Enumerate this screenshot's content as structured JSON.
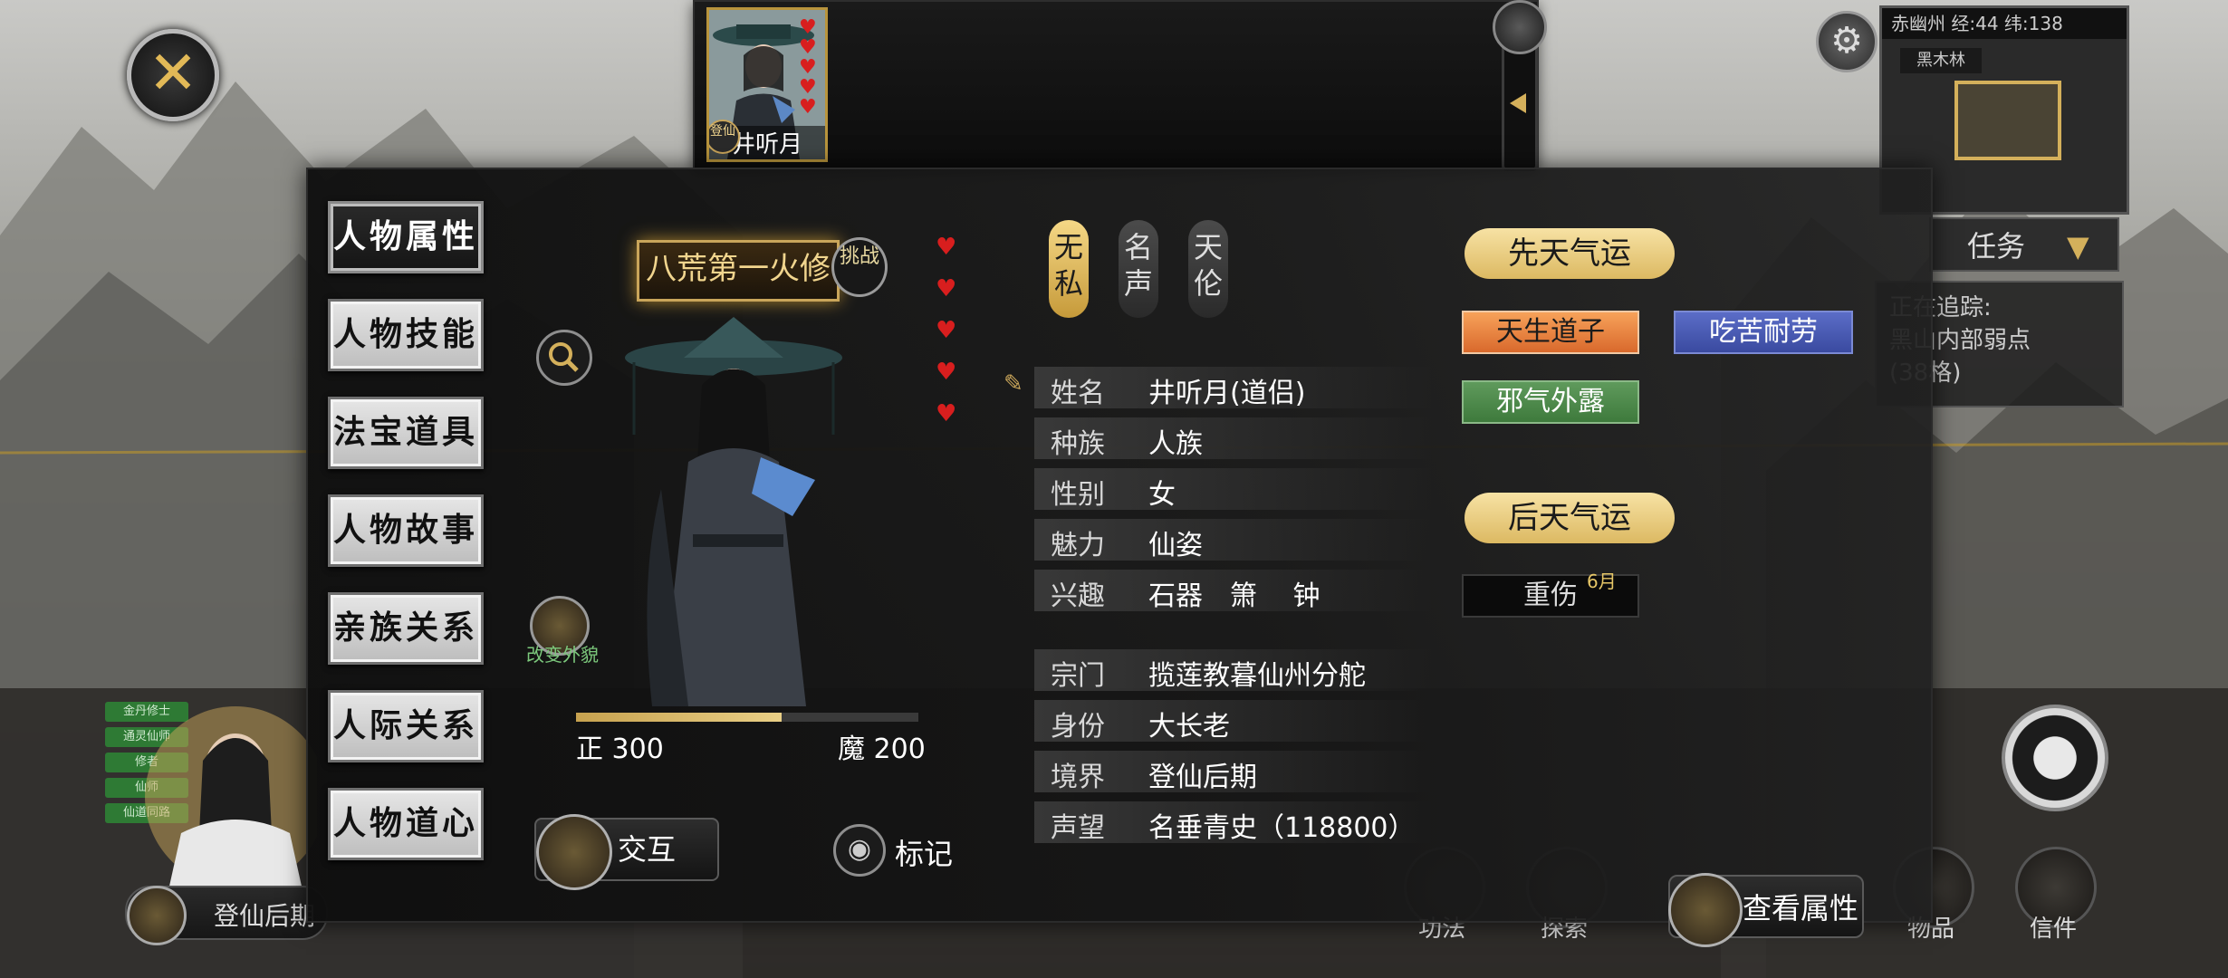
{
  "top": {
    "portrait_name": "井听月",
    "portrait_badge": "登仙",
    "hearts": 5
  },
  "minimap": {
    "title": "赤幽州 经:44 纬:138",
    "subtitle": "黑木林"
  },
  "task": {
    "tab_label": "任务",
    "tracker_title": "正在追踪:",
    "tracker_lines": [
      "黑山内部弱点",
      "(38格)"
    ]
  },
  "nav": {
    "items": [
      "人物属性",
      "人物技能",
      "法宝道具",
      "人物故事",
      "亲族关系",
      "人际关系",
      "人物道心"
    ],
    "active_index": 0
  },
  "character": {
    "title_badge": "八荒第一火修",
    "challenge_label": "挑战",
    "appearance_label": "改变外貌",
    "righteous_label": "正 300",
    "demonic_label": "魔 200",
    "righteous_fraction": 0.6,
    "interact_label": "交互",
    "mark_label": "标记",
    "hearts": 5
  },
  "tabs": [
    {
      "line1": "无",
      "line2": "私",
      "active": true
    },
    {
      "line1": "名",
      "line2": "声",
      "active": false
    },
    {
      "line1": "天",
      "line2": "伦",
      "active": false
    }
  ],
  "info": {
    "rows1": [
      {
        "key": "姓名",
        "value": "井听月(道侣)"
      },
      {
        "key": "种族",
        "value": "人族"
      },
      {
        "key": "性别",
        "value": "女"
      },
      {
        "key": "魅力",
        "value": "仙姿"
      },
      {
        "key": "兴趣",
        "value": "石器　箫　 钟"
      }
    ],
    "rows2": [
      {
        "key": "宗门",
        "value": "揽莲教暮仙州分舵"
      },
      {
        "key": "身份",
        "value": "大长老"
      },
      {
        "key": "境界",
        "value": "登仙后期"
      },
      {
        "key": "声望",
        "value": "名垂青史（118800）"
      }
    ]
  },
  "fortune": {
    "innate_title": "先天气运",
    "innate_traits": [
      "天生道子",
      "吃苦耐劳",
      "邪气外露"
    ],
    "trait_colors": [
      "#e27a34",
      "#4656b0",
      "#4f8a4c"
    ],
    "acquired_title": "后天气运",
    "acquired": {
      "label": "重伤",
      "duration": "6月"
    }
  },
  "view_attr_label": "查看属性",
  "left_char": {
    "realm": "登仙后期",
    "tags": [
      "金丹修士",
      "通灵仙师",
      "修者",
      "仙师",
      "仙道同路"
    ]
  },
  "bottom_menu": [
    "功法",
    "探索",
    "",
    "",
    "物品",
    "信件"
  ]
}
